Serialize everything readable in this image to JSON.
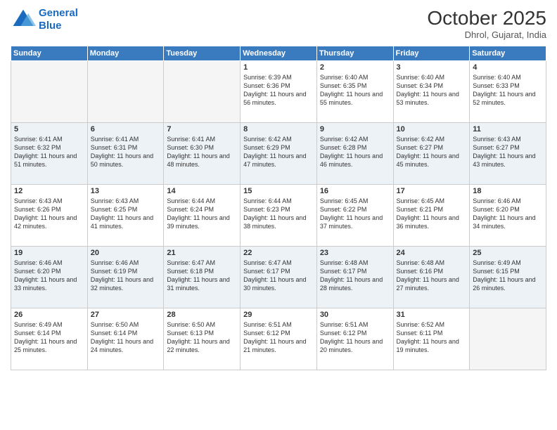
{
  "logo": {
    "line1": "General",
    "line2": "Blue"
  },
  "title": "October 2025",
  "location": "Dhrol, Gujarat, India",
  "headers": [
    "Sunday",
    "Monday",
    "Tuesday",
    "Wednesday",
    "Thursday",
    "Friday",
    "Saturday"
  ],
  "weeks": [
    [
      {
        "day": "",
        "sunrise": "",
        "sunset": "",
        "daylight": "",
        "empty": true
      },
      {
        "day": "",
        "sunrise": "",
        "sunset": "",
        "daylight": "",
        "empty": true
      },
      {
        "day": "",
        "sunrise": "",
        "sunset": "",
        "daylight": "",
        "empty": true
      },
      {
        "day": "1",
        "sunrise": "Sunrise: 6:39 AM",
        "sunset": "Sunset: 6:36 PM",
        "daylight": "Daylight: 11 hours and 56 minutes.",
        "empty": false
      },
      {
        "day": "2",
        "sunrise": "Sunrise: 6:40 AM",
        "sunset": "Sunset: 6:35 PM",
        "daylight": "Daylight: 11 hours and 55 minutes.",
        "empty": false
      },
      {
        "day": "3",
        "sunrise": "Sunrise: 6:40 AM",
        "sunset": "Sunset: 6:34 PM",
        "daylight": "Daylight: 11 hours and 53 minutes.",
        "empty": false
      },
      {
        "day": "4",
        "sunrise": "Sunrise: 6:40 AM",
        "sunset": "Sunset: 6:33 PM",
        "daylight": "Daylight: 11 hours and 52 minutes.",
        "empty": false
      }
    ],
    [
      {
        "day": "5",
        "sunrise": "Sunrise: 6:41 AM",
        "sunset": "Sunset: 6:32 PM",
        "daylight": "Daylight: 11 hours and 51 minutes.",
        "empty": false
      },
      {
        "day": "6",
        "sunrise": "Sunrise: 6:41 AM",
        "sunset": "Sunset: 6:31 PM",
        "daylight": "Daylight: 11 hours and 50 minutes.",
        "empty": false
      },
      {
        "day": "7",
        "sunrise": "Sunrise: 6:41 AM",
        "sunset": "Sunset: 6:30 PM",
        "daylight": "Daylight: 11 hours and 48 minutes.",
        "empty": false
      },
      {
        "day": "8",
        "sunrise": "Sunrise: 6:42 AM",
        "sunset": "Sunset: 6:29 PM",
        "daylight": "Daylight: 11 hours and 47 minutes.",
        "empty": false
      },
      {
        "day": "9",
        "sunrise": "Sunrise: 6:42 AM",
        "sunset": "Sunset: 6:28 PM",
        "daylight": "Daylight: 11 hours and 46 minutes.",
        "empty": false
      },
      {
        "day": "10",
        "sunrise": "Sunrise: 6:42 AM",
        "sunset": "Sunset: 6:27 PM",
        "daylight": "Daylight: 11 hours and 45 minutes.",
        "empty": false
      },
      {
        "day": "11",
        "sunrise": "Sunrise: 6:43 AM",
        "sunset": "Sunset: 6:27 PM",
        "daylight": "Daylight: 11 hours and 43 minutes.",
        "empty": false
      }
    ],
    [
      {
        "day": "12",
        "sunrise": "Sunrise: 6:43 AM",
        "sunset": "Sunset: 6:26 PM",
        "daylight": "Daylight: 11 hours and 42 minutes.",
        "empty": false
      },
      {
        "day": "13",
        "sunrise": "Sunrise: 6:43 AM",
        "sunset": "Sunset: 6:25 PM",
        "daylight": "Daylight: 11 hours and 41 minutes.",
        "empty": false
      },
      {
        "day": "14",
        "sunrise": "Sunrise: 6:44 AM",
        "sunset": "Sunset: 6:24 PM",
        "daylight": "Daylight: 11 hours and 39 minutes.",
        "empty": false
      },
      {
        "day": "15",
        "sunrise": "Sunrise: 6:44 AM",
        "sunset": "Sunset: 6:23 PM",
        "daylight": "Daylight: 11 hours and 38 minutes.",
        "empty": false
      },
      {
        "day": "16",
        "sunrise": "Sunrise: 6:45 AM",
        "sunset": "Sunset: 6:22 PM",
        "daylight": "Daylight: 11 hours and 37 minutes.",
        "empty": false
      },
      {
        "day": "17",
        "sunrise": "Sunrise: 6:45 AM",
        "sunset": "Sunset: 6:21 PM",
        "daylight": "Daylight: 11 hours and 36 minutes.",
        "empty": false
      },
      {
        "day": "18",
        "sunrise": "Sunrise: 6:46 AM",
        "sunset": "Sunset: 6:20 PM",
        "daylight": "Daylight: 11 hours and 34 minutes.",
        "empty": false
      }
    ],
    [
      {
        "day": "19",
        "sunrise": "Sunrise: 6:46 AM",
        "sunset": "Sunset: 6:20 PM",
        "daylight": "Daylight: 11 hours and 33 minutes.",
        "empty": false
      },
      {
        "day": "20",
        "sunrise": "Sunrise: 6:46 AM",
        "sunset": "Sunset: 6:19 PM",
        "daylight": "Daylight: 11 hours and 32 minutes.",
        "empty": false
      },
      {
        "day": "21",
        "sunrise": "Sunrise: 6:47 AM",
        "sunset": "Sunset: 6:18 PM",
        "daylight": "Daylight: 11 hours and 31 minutes.",
        "empty": false
      },
      {
        "day": "22",
        "sunrise": "Sunrise: 6:47 AM",
        "sunset": "Sunset: 6:17 PM",
        "daylight": "Daylight: 11 hours and 30 minutes.",
        "empty": false
      },
      {
        "day": "23",
        "sunrise": "Sunrise: 6:48 AM",
        "sunset": "Sunset: 6:17 PM",
        "daylight": "Daylight: 11 hours and 28 minutes.",
        "empty": false
      },
      {
        "day": "24",
        "sunrise": "Sunrise: 6:48 AM",
        "sunset": "Sunset: 6:16 PM",
        "daylight": "Daylight: 11 hours and 27 minutes.",
        "empty": false
      },
      {
        "day": "25",
        "sunrise": "Sunrise: 6:49 AM",
        "sunset": "Sunset: 6:15 PM",
        "daylight": "Daylight: 11 hours and 26 minutes.",
        "empty": false
      }
    ],
    [
      {
        "day": "26",
        "sunrise": "Sunrise: 6:49 AM",
        "sunset": "Sunset: 6:14 PM",
        "daylight": "Daylight: 11 hours and 25 minutes.",
        "empty": false
      },
      {
        "day": "27",
        "sunrise": "Sunrise: 6:50 AM",
        "sunset": "Sunset: 6:14 PM",
        "daylight": "Daylight: 11 hours and 24 minutes.",
        "empty": false
      },
      {
        "day": "28",
        "sunrise": "Sunrise: 6:50 AM",
        "sunset": "Sunset: 6:13 PM",
        "daylight": "Daylight: 11 hours and 22 minutes.",
        "empty": false
      },
      {
        "day": "29",
        "sunrise": "Sunrise: 6:51 AM",
        "sunset": "Sunset: 6:12 PM",
        "daylight": "Daylight: 11 hours and 21 minutes.",
        "empty": false
      },
      {
        "day": "30",
        "sunrise": "Sunrise: 6:51 AM",
        "sunset": "Sunset: 6:12 PM",
        "daylight": "Daylight: 11 hours and 20 minutes.",
        "empty": false
      },
      {
        "day": "31",
        "sunrise": "Sunrise: 6:52 AM",
        "sunset": "Sunset: 6:11 PM",
        "daylight": "Daylight: 11 hours and 19 minutes.",
        "empty": false
      },
      {
        "day": "",
        "sunrise": "",
        "sunset": "",
        "daylight": "",
        "empty": true
      }
    ]
  ]
}
